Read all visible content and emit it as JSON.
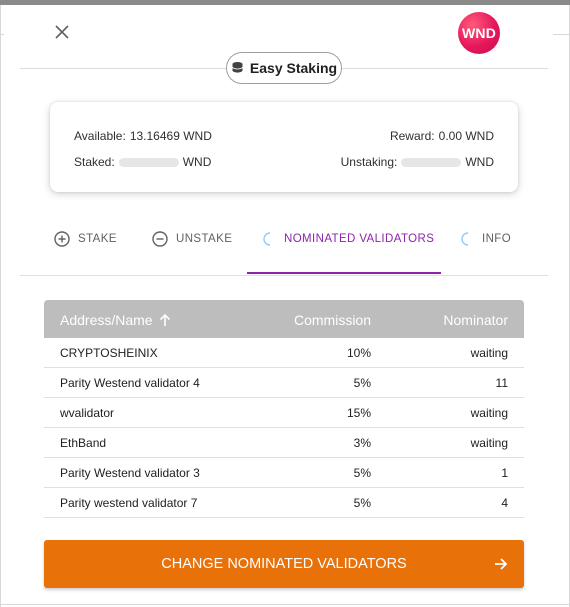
{
  "header": {
    "avatar_text": "WND",
    "title": "Easy Staking"
  },
  "summary": {
    "available_label": "Available:",
    "available_value": "13.16469 WND",
    "reward_label": "Reward:",
    "reward_value": "0.00 WND",
    "staked_label": "Staked:",
    "staked_unit": "WND",
    "unstaking_label": "Unstaking:",
    "unstaking_unit": "WND"
  },
  "tabs": [
    {
      "label": "STAKE",
      "icon": "plus-circle-icon"
    },
    {
      "label": "UNSTAKE",
      "icon": "minus-circle-icon"
    },
    {
      "label": "NOMINATED VALIDATORS",
      "icon": "loading-spinner-icon",
      "active": true
    },
    {
      "label": "INFO",
      "icon": "loading-spinner-icon"
    }
  ],
  "table": {
    "headers": {
      "address": "Address/Name",
      "commission": "Commission",
      "nominator": "Nominator"
    },
    "rows": [
      {
        "name": "CRYPTOSHEINIX",
        "commission": "10%",
        "nominator": "waiting"
      },
      {
        "name": "Parity Westend validator 4",
        "commission": "5%",
        "nominator": "11"
      },
      {
        "name": "wvalidator",
        "commission": "15%",
        "nominator": "waiting"
      },
      {
        "name": "EthBand",
        "commission": "3%",
        "nominator": "waiting"
      },
      {
        "name": "Parity Westend validator 3",
        "commission": "5%",
        "nominator": "1"
      },
      {
        "name": "Parity westend validator 7",
        "commission": "5%",
        "nominator": "4"
      }
    ]
  },
  "cta": {
    "label": "CHANGE NOMINATED VALIDATORS"
  },
  "colors": {
    "accent_purple": "#8e24aa",
    "cta_orange": "#e8710a",
    "table_header_gray": "#bdbdbd",
    "avatar_pink": "#e6175c"
  }
}
